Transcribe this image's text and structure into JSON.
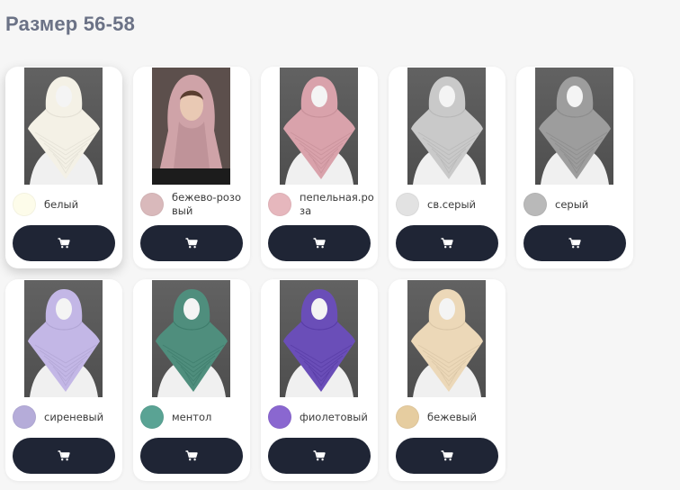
{
  "heading": "Размер 56-58",
  "products": [
    {
      "color_name": "белый",
      "swatch": "#fdfcea",
      "scarf": "#f4f1e6",
      "person": false
    },
    {
      "color_name": "бежево-розовый",
      "swatch": "#d9b9bb",
      "scarf": "#cfa3a8",
      "person": true
    },
    {
      "color_name": "пепельная.роза",
      "swatch": "#e6b7bd",
      "scarf": "#d9a2ab",
      "person": false
    },
    {
      "color_name": "св.серый",
      "swatch": "#e2e2e2",
      "scarf": "#c9c9c9",
      "person": false
    },
    {
      "color_name": "серый",
      "swatch": "#b9b9b9",
      "scarf": "#9d9d9d",
      "person": false
    },
    {
      "color_name": "сиреневый",
      "swatch": "#b5acd9",
      "scarf": "#c3b7e6",
      "person": false
    },
    {
      "color_name": "ментол",
      "swatch": "#5aa394",
      "scarf": "#4f8e7d",
      "person": false
    },
    {
      "color_name": "фиолетовый",
      "swatch": "#8a67d0",
      "scarf": "#6a4eb8",
      "person": false
    },
    {
      "color_name": "бежевый",
      "swatch": "#e6cda0",
      "scarf": "#ecd8b8",
      "person": false
    }
  ],
  "cart_icon": "cart-icon"
}
